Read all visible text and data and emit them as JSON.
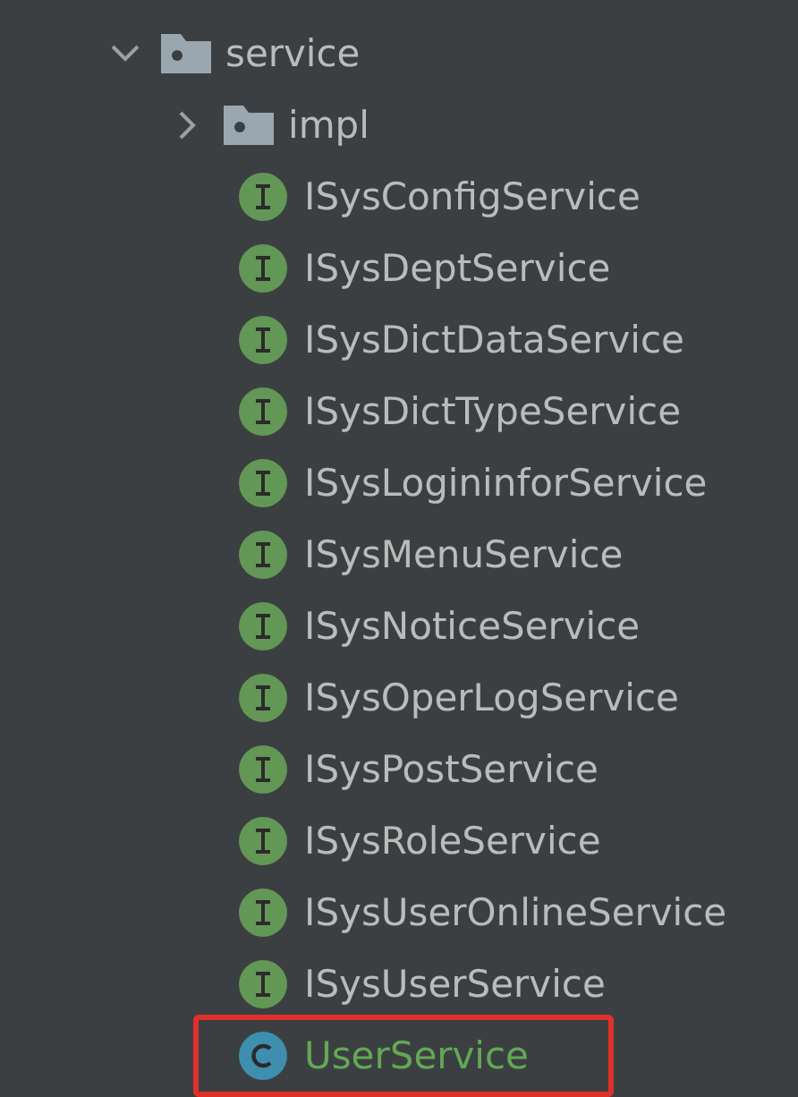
{
  "tree": [
    {
      "label": "service",
      "kind": "folder",
      "expanded": true,
      "children": [
        {
          "label": "impl",
          "kind": "folder",
          "expanded": false
        },
        {
          "label": "ISysConfigService",
          "kind": "interface",
          "added": false,
          "highlighted": false
        },
        {
          "label": "ISysDeptService",
          "kind": "interface",
          "added": false,
          "highlighted": false
        },
        {
          "label": "ISysDictDataService",
          "kind": "interface",
          "added": false,
          "highlighted": false
        },
        {
          "label": "ISysDictTypeService",
          "kind": "interface",
          "added": false,
          "highlighted": false
        },
        {
          "label": "ISysLogininforService",
          "kind": "interface",
          "added": false,
          "highlighted": false
        },
        {
          "label": "ISysMenuService",
          "kind": "interface",
          "added": false,
          "highlighted": false
        },
        {
          "label": "ISysNoticeService",
          "kind": "interface",
          "added": false,
          "highlighted": false
        },
        {
          "label": "ISysOperLogService",
          "kind": "interface",
          "added": false,
          "highlighted": false
        },
        {
          "label": "ISysPostService",
          "kind": "interface",
          "added": false,
          "highlighted": false
        },
        {
          "label": "ISysRoleService",
          "kind": "interface",
          "added": false,
          "highlighted": false
        },
        {
          "label": "ISysUserOnlineService",
          "kind": "interface",
          "added": false,
          "highlighted": false
        },
        {
          "label": "ISysUserService",
          "kind": "interface",
          "added": false,
          "highlighted": false
        },
        {
          "label": "UserService",
          "kind": "class",
          "added": true,
          "highlighted": true
        }
      ]
    }
  ]
}
